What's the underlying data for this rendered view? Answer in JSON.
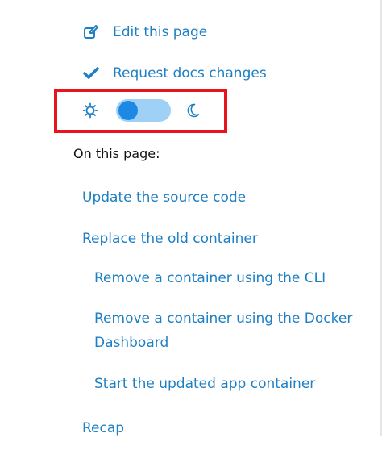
{
  "actions": {
    "edit": {
      "label": "Edit this page",
      "icon": "edit-icon"
    },
    "request": {
      "label": "Request docs changes",
      "icon": "check-icon"
    }
  },
  "theme_toggle": {
    "sun_icon": "sun-icon",
    "moon_icon": "moon-icon",
    "state": "light"
  },
  "toc": {
    "title": "On this page:",
    "items": [
      {
        "label": "Update the source code",
        "level": 1
      },
      {
        "label": "Replace the old container",
        "level": 1
      },
      {
        "label": "Remove a container using the CLI",
        "level": 2
      },
      {
        "label": "Remove a container using the Docker Dashboard",
        "level": 2
      },
      {
        "label": "Start the updated app container",
        "level": 2
      },
      {
        "label": "Recap",
        "level": 1
      }
    ]
  },
  "colors": {
    "link": "#1d7fc4",
    "highlight": "#e8141d",
    "toggle_track": "#9fd0f5",
    "toggle_knob": "#1e88e5"
  }
}
